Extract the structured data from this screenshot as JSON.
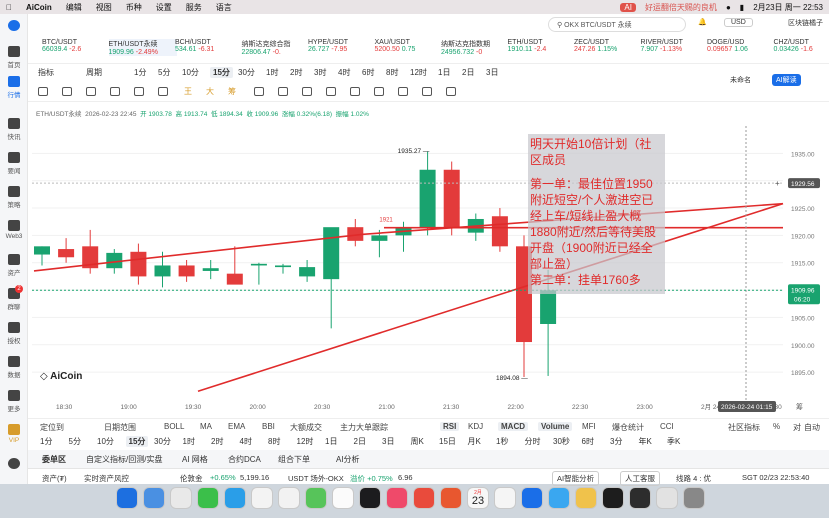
{
  "menubar": {
    "app": "AiCoin",
    "menus": [
      "编辑",
      "视图",
      "币种",
      "设置",
      "服务",
      "语言"
    ],
    "notification": "好运翻倍天赐的良机",
    "date_time": "2月23日 周一 22:53"
  },
  "topbar": {
    "search_placeholder": "OKX BTC/USDT 永续",
    "currency": "USD",
    "assistant": "区块链橘子"
  },
  "sidebar": {
    "items": [
      "首页",
      "行情",
      "快讯",
      "要闻",
      "策略",
      "Web3",
      "资产",
      "群聊",
      "授权",
      "数据",
      "更多",
      "VIP",
      "设置"
    ],
    "badge": "2"
  },
  "tickers": [
    {
      "name": "BTC/USDT",
      "price": "66039.4",
      "change": "-2.6"
    },
    {
      "name": "ETH/USDT永续",
      "price": "1909.96",
      "change": "-2.49%"
    },
    {
      "name": "BCH/USDT",
      "price": "534.61",
      "change": "-6.31"
    },
    {
      "name": "纳斯达克综合指",
      "price": "22806.47",
      "change": "-0."
    },
    {
      "name": "HYPE/USDT",
      "price": "26.727",
      "change": "-7.95"
    },
    {
      "name": "XAU/USDT",
      "price": "5200.50",
      "change": "0.75"
    },
    {
      "name": "纳斯达克指数期",
      "price": "24956.732",
      "change": "-0"
    },
    {
      "name": "ETH/USDT",
      "price": "1910.11",
      "change": "-2.4"
    },
    {
      "name": "ZEC/USDT",
      "price": "247.26",
      "change": "1.15%"
    },
    {
      "name": "RIVER/USDT",
      "price": "7.907",
      "change": "-1.13%"
    },
    {
      "name": "DOGE/USD",
      "price": "0.09657",
      "change": "1.06"
    },
    {
      "name": "CHZ/USDT",
      "price": "0.03426",
      "change": "-1.6"
    }
  ],
  "periods": [
    "指标",
    "周期",
    "1分",
    "5分",
    "10分",
    "15分",
    "30分",
    "1时",
    "2时",
    "3时",
    "4时",
    "6时",
    "8时",
    "12时",
    "1日",
    "2日",
    "3日"
  ],
  "period_selected": "15分",
  "toolbar_right": {
    "no_pref": "未命名",
    "ai": "AI解读"
  },
  "draw_colors": [
    "王",
    "大",
    "筹"
  ],
  "chart_header": {
    "symbol": "ETH/USDT永续",
    "datetime": "2026-02-23 22:45",
    "open": "开 1903.78",
    "high": "高 1913.74",
    "low": "低 1894.34",
    "close": "收 1909.96",
    "change": "涨幅 0.32%(6.18)",
    "amplitude": "振幅 1.02%"
  },
  "chart_data": {
    "type": "candlestick",
    "x_labels": [
      "18:30",
      "19:00",
      "19:30",
      "20:00",
      "20:30",
      "21:00",
      "21:30",
      "22:00",
      "22:30",
      "23:00",
      "2月 24",
      "00:30"
    ],
    "y_ticks": [
      1935.0,
      1930.0,
      1925.0,
      1920.0,
      1915.0,
      1910.0,
      1905.0,
      1900.0,
      1895.0
    ],
    "ylim": [
      1891,
      1940
    ],
    "candles": [
      {
        "o": 1916.5,
        "h": 1918.0,
        "l": 1914.5,
        "c": 1918.0
      },
      {
        "o": 1917.5,
        "h": 1919.5,
        "l": 1915.0,
        "c": 1916.0
      },
      {
        "o": 1918.0,
        "h": 1921.0,
        "l": 1913.0,
        "c": 1914.0
      },
      {
        "o": 1914.0,
        "h": 1917.5,
        "l": 1913.0,
        "c": 1916.8
      },
      {
        "o": 1917.0,
        "h": 1918.5,
        "l": 1911.0,
        "c": 1912.5
      },
      {
        "o": 1912.5,
        "h": 1917.0,
        "l": 1910.5,
        "c": 1914.5
      },
      {
        "o": 1914.5,
        "h": 1915.5,
        "l": 1911.5,
        "c": 1912.5
      },
      {
        "o": 1913.5,
        "h": 1915.5,
        "l": 1912.0,
        "c": 1914.0
      },
      {
        "o": 1913.0,
        "h": 1918.0,
        "l": 1911.5,
        "c": 1911.0
      },
      {
        "o": 1914.5,
        "h": 1915.0,
        "l": 1911.0,
        "c": 1914.8
      },
      {
        "o": 1914.2,
        "h": 1914.8,
        "l": 1913.0,
        "c": 1914.5
      },
      {
        "o": 1912.5,
        "h": 1915.5,
        "l": 1911.5,
        "c": 1914.2
      },
      {
        "o": 1912.0,
        "h": 1921.0,
        "l": 1903.0,
        "c": 1921.5
      },
      {
        "o": 1921.5,
        "h": 1923.0,
        "l": 1918.0,
        "c": 1919.0
      },
      {
        "o": 1919.0,
        "h": 1921.0,
        "l": 1916.0,
        "c": 1920.0
      },
      {
        "o": 1920.0,
        "h": 1922.5,
        "l": 1917.0,
        "c": 1921.5
      },
      {
        "o": 1921.5,
        "h": 1935.3,
        "l": 1920.0,
        "c": 1932.0
      },
      {
        "o": 1932.0,
        "h": 1933.5,
        "l": 1920.0,
        "c": 1921.5
      },
      {
        "o": 1920.5,
        "h": 1924.0,
        "l": 1919.0,
        "c": 1923.0
      },
      {
        "o": 1923.5,
        "h": 1925.0,
        "l": 1917.0,
        "c": 1918.0
      },
      {
        "o": 1918.0,
        "h": 1920.0,
        "l": 1894.1,
        "c": 1900.5
      },
      {
        "o": 1903.8,
        "h": 1913.7,
        "l": 1894.3,
        "c": 1909.96
      }
    ],
    "annotations": {
      "high": "1935.27",
      "low": "1894.08",
      "mid_label": "1921"
    },
    "current_price": "1909.96",
    "countdown": "06:20",
    "cursor_price": "1929.56",
    "cursor_time": "2026-02-24 01:15"
  },
  "annotation_text": {
    "line1": "明天开始10倍计划（社区成员",
    "line2": "第一单：最佳位置1950附近短空/个人激进空已经上车/短线止盈大概1880附近/然后等待美股开盘（1900附近已经全部止盈）",
    "line3": "第二单：挂单1760多"
  },
  "indicators": {
    "left": [
      "定位到",
      "日期范围",
      "BOLL",
      "MA",
      "EMA",
      "BBI",
      "大额成交",
      "主力大单跟踪"
    ],
    "right": [
      "RSI",
      "KDJ",
      "MACD",
      "Volume",
      "MFI",
      "爆仓统计",
      "CCI"
    ],
    "community": "社区指标",
    "pct": "%",
    "auto": "自动",
    "log": "对"
  },
  "periods2": [
    "1分",
    "5分",
    "10分",
    "15分",
    "30分",
    "1时",
    "2时",
    "4时",
    "8时",
    "12时",
    "1日",
    "2日",
    "3日",
    "周K",
    "15日",
    "月K",
    "1秒",
    "分时",
    "30秒",
    "6时",
    "3分",
    "年K",
    "季K"
  ],
  "bottom_tabs": [
    "委单区",
    "自定义指标/回测/实盘",
    "AI 网格",
    "合约DCA",
    "组合下单",
    "AI分析"
  ],
  "statusbar": {
    "assets": "资产(₮)",
    "risk": "实时资产风控",
    "funding_label": "伦敦金",
    "funding_change": "+0.65%",
    "funding_value": "5,199.16",
    "usdt_label": "USDT 场外-OKX",
    "usdt_change": "溢价 +0.75%",
    "usdt_value": "6.96",
    "ai_btn": "AI智能分析",
    "cs_btn": "人工客服",
    "line": "线路 4 : 优",
    "time": "SGT 02/23 22:53:40"
  },
  "dock": {
    "date_icon": "23",
    "date_month": "2月"
  },
  "brand": "AiCoin",
  "colors": {
    "up": "#19a36f",
    "down": "#e33b3b",
    "accent": "#1a6ee8",
    "annotation": "#e02b2b"
  }
}
